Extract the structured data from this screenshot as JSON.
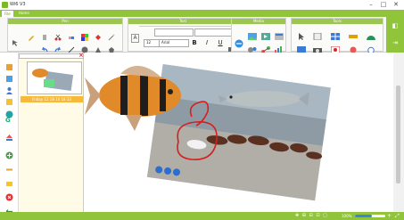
{
  "window": {
    "title": "Wi6 V3",
    "controls": [
      "–",
      "□",
      "✕"
    ]
  },
  "menu": {
    "tabs": [
      "File",
      "Home"
    ]
  },
  "ribbon": {
    "groups": [
      {
        "id": "pen",
        "title": "Pen"
      },
      {
        "id": "text",
        "title": "Text"
      },
      {
        "id": "media",
        "title": "Media"
      },
      {
        "id": "tools",
        "title": "Tools"
      }
    ],
    "font_size": "12",
    "font_name": "Arial",
    "bold": "B",
    "italic": "I",
    "underline": "U"
  },
  "pages": {
    "thumb_label": "Friday 12 18 10 18 33"
  },
  "status": {
    "zoom_text": "100%",
    "zoom_percent": 55
  },
  "colors": {
    "accent": "#8fc43b",
    "header": "#9bc64f",
    "thumb_label": "#f7b93a"
  }
}
